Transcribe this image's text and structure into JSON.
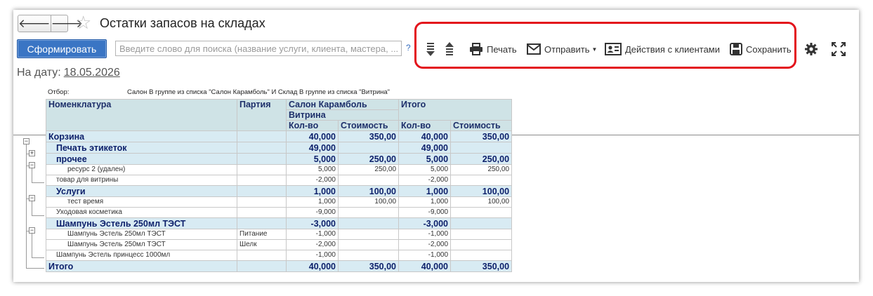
{
  "nav": {
    "back": "🡐",
    "forward": "🡒"
  },
  "title": "Остатки запасов на складах",
  "generate_label": "Сформировать",
  "search": {
    "placeholder": "Введите слово для поиска (название услуги, клиента, мастера, ...",
    "help": "?"
  },
  "toolbar": {
    "print": "Печать",
    "send": "Отправить",
    "client_actions": "Действия с клиентами",
    "save": "Сохранить"
  },
  "date": {
    "label": "На дату:",
    "value": "18.05.2026"
  },
  "filter": {
    "label": "Отбор:",
    "value": "Салон В группе из списка \"Салон Карамболь\" И Склад В группе из списка \"Витрина\""
  },
  "headers": {
    "nomenclature": "Номенклатура",
    "batch": "Партия",
    "salon": "Салон Карамболь",
    "warehouse": "Витрина",
    "total": "Итого",
    "qty": "Кол-во",
    "cost": "Стоимость"
  },
  "rows": [
    {
      "name": "Корзина",
      "batch": "",
      "qty": "40,000",
      "cost": "350,00",
      "tqty": "40,000",
      "tcost": "350,00"
    },
    {
      "name": "Печать этикеток",
      "batch": "",
      "qty": "49,000",
      "cost": "",
      "tqty": "49,000",
      "tcost": ""
    },
    {
      "name": "прочее",
      "batch": "",
      "qty": "5,000",
      "cost": "250,00",
      "tqty": "5,000",
      "tcost": "250,00"
    },
    {
      "name": "ресурс 2 (удален)",
      "batch": "",
      "qty": "5,000",
      "cost": "250,00",
      "tqty": "5,000",
      "tcost": "250,00"
    },
    {
      "name": "товар для витрины",
      "batch": "",
      "qty": "-2,000",
      "cost": "",
      "tqty": "-2,000",
      "tcost": ""
    },
    {
      "name": "Услуги",
      "batch": "",
      "qty": "1,000",
      "cost": "100,00",
      "tqty": "1,000",
      "tcost": "100,00"
    },
    {
      "name": "тест время",
      "batch": "",
      "qty": "1,000",
      "cost": "100,00",
      "tqty": "1,000",
      "tcost": "100,00"
    },
    {
      "name": "Уходовая косметика",
      "batch": "",
      "qty": "-9,000",
      "cost": "",
      "tqty": "-9,000",
      "tcost": ""
    },
    {
      "name": "Шампунь Эстель 250мл ТЭСТ",
      "batch": "",
      "qty": "-3,000",
      "cost": "",
      "tqty": "-3,000",
      "tcost": ""
    },
    {
      "name": "Шампунь Эстель 250мл ТЭСТ",
      "batch": "Питание",
      "qty": "-1,000",
      "cost": "",
      "tqty": "-1,000",
      "tcost": ""
    },
    {
      "name": "Шампунь Эстель 250мл ТЭСТ",
      "batch": "Шелк",
      "qty": "-2,000",
      "cost": "",
      "tqty": "-2,000",
      "tcost": ""
    },
    {
      "name": "Шампунь Эстель принцесс 1000мл",
      "batch": "",
      "qty": "-1,000",
      "cost": "",
      "tqty": "-1,000",
      "tcost": ""
    }
  ],
  "totals": {
    "name": "Итого",
    "qty": "40,000",
    "cost": "350,00",
    "tqty": "40,000",
    "tcost": "350,00"
  },
  "tree": {
    "collapse": "−",
    "expand": "+"
  },
  "colors": {
    "accent": "#3a75c4",
    "highlight": "#e3131b",
    "header_bg": "#cfe3e6",
    "group_bg": "#d8ebf3"
  }
}
